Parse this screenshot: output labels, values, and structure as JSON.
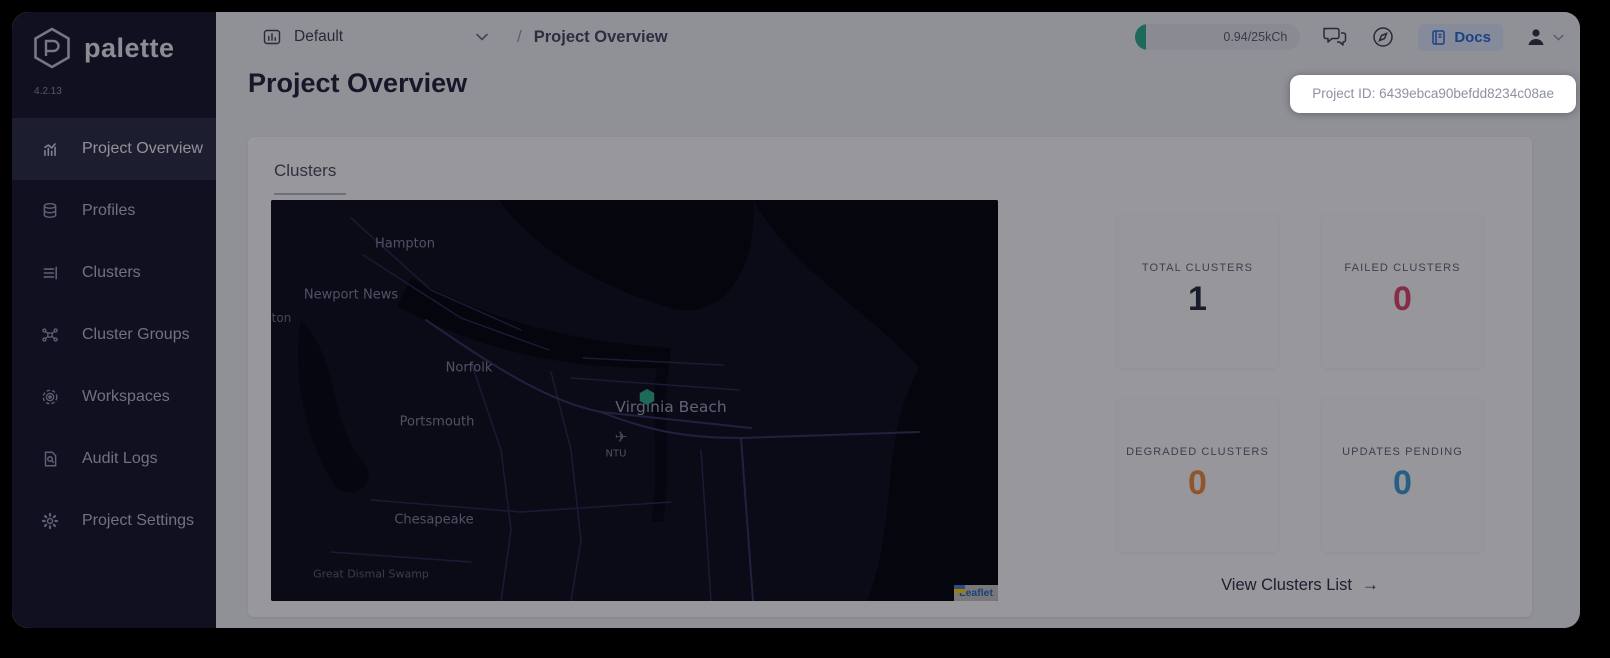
{
  "app": {
    "name": "palette",
    "version": "4.2.13"
  },
  "sidebar": {
    "items": [
      {
        "label": "Project Overview",
        "active": true
      },
      {
        "label": "Profiles",
        "active": false
      },
      {
        "label": "Clusters",
        "active": false
      },
      {
        "label": "Cluster Groups",
        "active": false
      },
      {
        "label": "Workspaces",
        "active": false
      },
      {
        "label": "Audit Logs",
        "active": false
      },
      {
        "label": "Project Settings",
        "active": false
      }
    ]
  },
  "topbar": {
    "scope_selector": {
      "value": "Default"
    },
    "breadcrumb": {
      "separator": "/",
      "current": "Project Overview"
    },
    "usage_badge": {
      "text": "0.94/25kCh",
      "fill_color": "#2fae8e"
    },
    "docs_button": {
      "label": "Docs"
    }
  },
  "project_tooltip": {
    "text": "Project ID: 6439ebca90befdd8234c08ae"
  },
  "page": {
    "title": "Project Overview"
  },
  "clusters_card": {
    "tab_label": "Clusters",
    "stats": [
      {
        "label": "TOTAL CLUSTERS",
        "value": "1",
        "color": "#262a3d"
      },
      {
        "label": "FAILED CLUSTERS",
        "value": "0",
        "color": "#df486f"
      },
      {
        "label": "DEGRADED CLUSTERS",
        "value": "0",
        "color": "#ee8d3c"
      },
      {
        "label": "UPDATES PENDING",
        "value": "0",
        "color": "#3d9bd6"
      }
    ],
    "view_clusters_link": {
      "label": "View Clusters List"
    },
    "map": {
      "labels": [
        {
          "text": "Hampton"
        },
        {
          "text": "Newport News"
        },
        {
          "text": "llton"
        },
        {
          "text": "Norfolk"
        },
        {
          "text": "Virginia Beach"
        },
        {
          "text": "Portsmouth"
        },
        {
          "text": "NTU"
        },
        {
          "text": "Chesapeake"
        },
        {
          "text": "Great Dismal Swamp"
        }
      ],
      "marker_color": "#2fae8e",
      "attribution": "Leaflet"
    }
  },
  "icons": {
    "airport": "✈",
    "arrow_right": "→"
  }
}
